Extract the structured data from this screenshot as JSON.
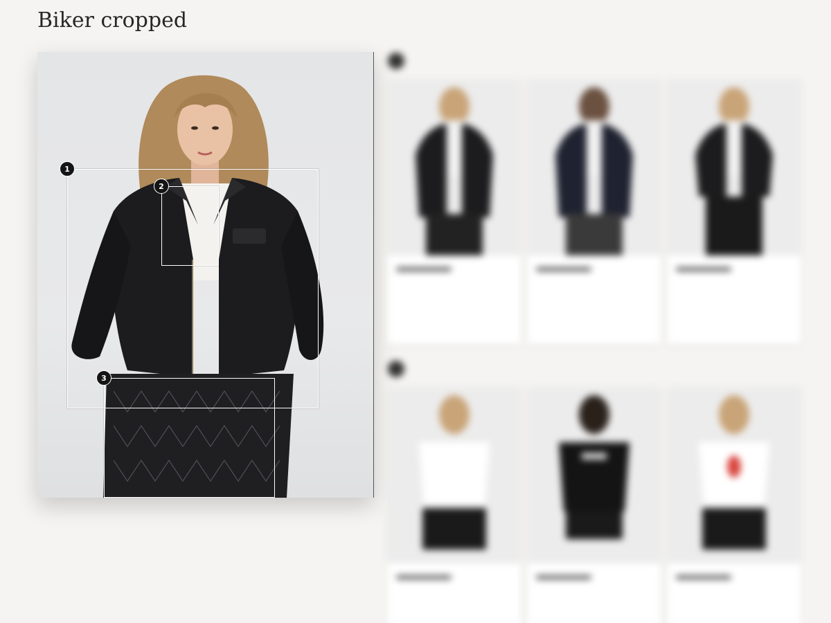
{
  "page": {
    "title": "Biker cropped"
  },
  "hotspots": [
    {
      "number": "1"
    },
    {
      "number": "2"
    },
    {
      "number": "3"
    }
  ],
  "colors": {
    "background": "#f5f4f2",
    "badge": "#141414",
    "hotspot_border": "#ffffff",
    "jacket": "#1c1c1e",
    "hair": "#b08a5a"
  },
  "sections": [
    {
      "number": "1",
      "heading": "",
      "items": [
        {
          "tag": "",
          "name": "",
          "price": "",
          "sub": ""
        },
        {
          "tag": "",
          "name": "",
          "price": "",
          "sub": ""
        },
        {
          "tag": "",
          "name": "",
          "price": "",
          "sub": ""
        }
      ]
    },
    {
      "number": "2",
      "heading": "",
      "items": [
        {
          "tag": "",
          "name": "",
          "price": "",
          "sub": ""
        },
        {
          "tag": "",
          "name": "",
          "price": "",
          "sub": ""
        },
        {
          "tag": "",
          "name": "",
          "price": "",
          "sub": ""
        }
      ]
    }
  ]
}
